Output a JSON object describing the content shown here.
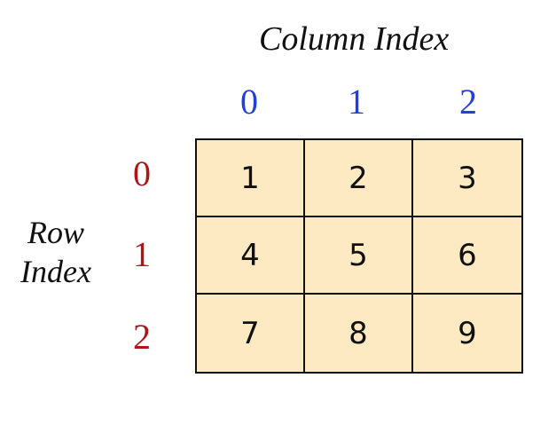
{
  "column_title": "Column Index",
  "row_title": [
    "Row",
    "Index"
  ],
  "column_indices": [
    "0",
    "1",
    "2"
  ],
  "row_indices": [
    "0",
    "1",
    "2"
  ],
  "matrix": [
    [
      "1",
      "2",
      "3"
    ],
    [
      "4",
      "5",
      "6"
    ],
    [
      "7",
      "8",
      "9"
    ]
  ],
  "colors": {
    "column_index": "#1f3fe0",
    "row_index": "#b01414",
    "cell_fill": "#fde9c2",
    "border": "#111111"
  }
}
